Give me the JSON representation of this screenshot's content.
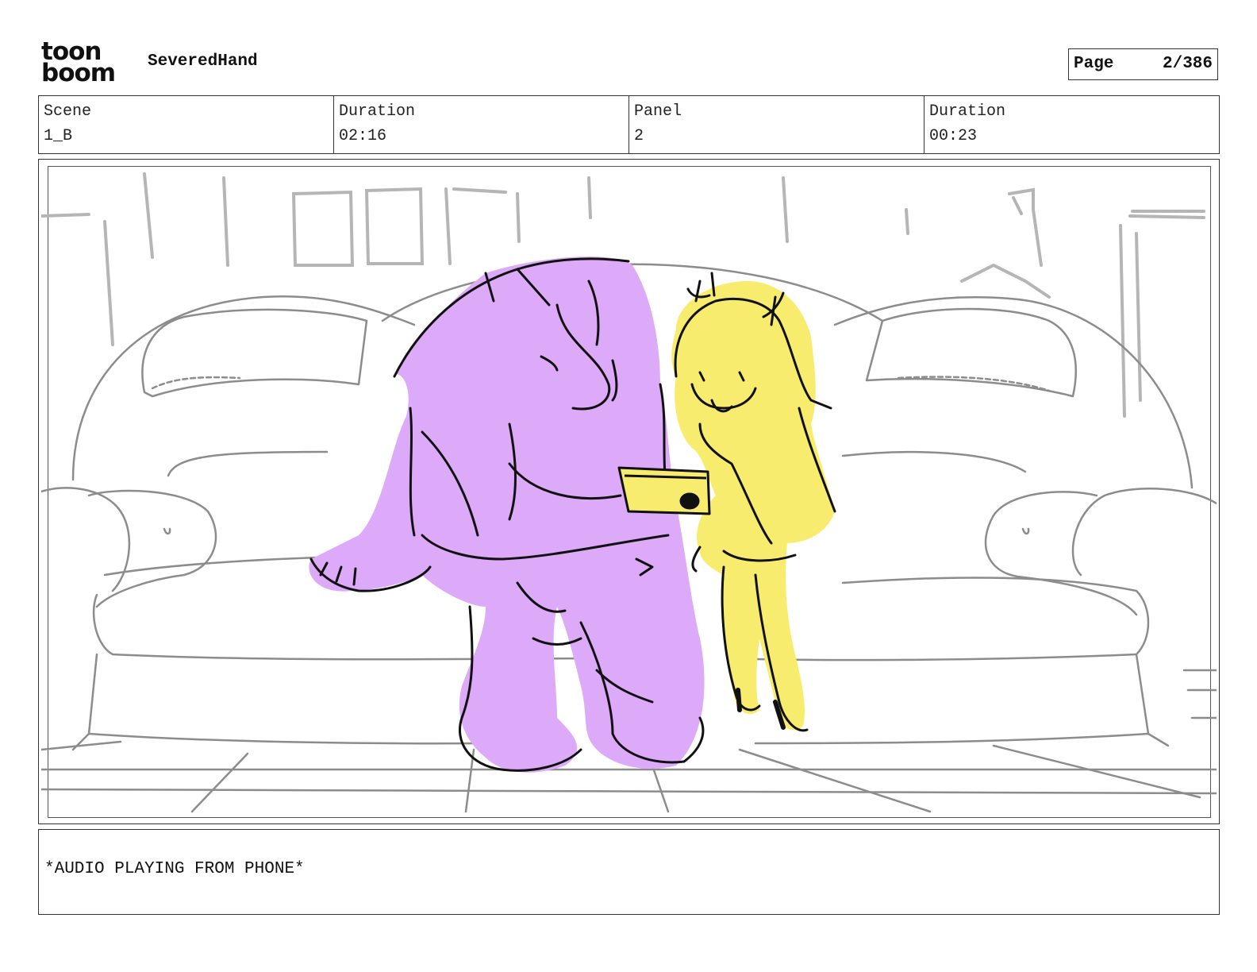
{
  "header": {
    "logo_lines": [
      "toon",
      "boom"
    ],
    "project_title": "SeveredHand",
    "page_label": "Page",
    "page_value": "2/386"
  },
  "info": [
    {
      "label": "Scene",
      "value": "1_B"
    },
    {
      "label": "Duration",
      "value": "02:16"
    },
    {
      "label": "Panel",
      "value": "2"
    },
    {
      "label": "Duration",
      "value": "00:23"
    }
  ],
  "panel": {
    "colors": {
      "character_left": "#dcaaf8",
      "character_right": "#f7ec6e",
      "background_lines": "#9a9a9a",
      "ink": "#111111"
    }
  },
  "dialogue": {
    "text": "*AUDIO PLAYING FROM PHONE*"
  }
}
